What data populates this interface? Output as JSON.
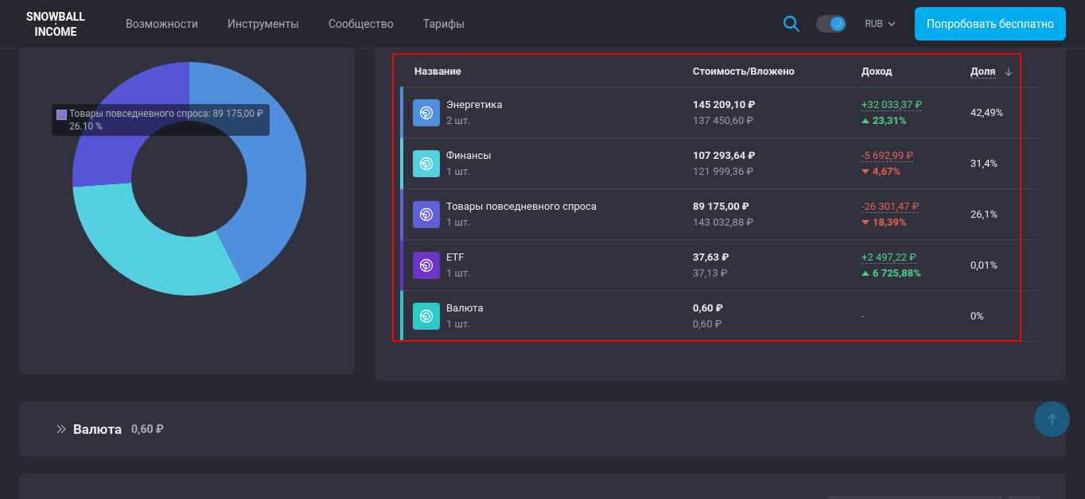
{
  "header": {
    "logo": [
      "SNOWBALL",
      "INCOME"
    ],
    "nav": [
      "Возможности",
      "Инструменты",
      "Сообщество",
      "Тарифы"
    ],
    "theme_toggle": {
      "on": true
    },
    "currency": "RUB",
    "cta": "Попробовать бесплатно"
  },
  "chart": {
    "tooltip": {
      "title": "Товары повседневного спроса: 89 175,00 ₽",
      "value": "26.10 %",
      "color": "#7b7bc8"
    }
  },
  "table": {
    "columns": [
      "Название",
      "Стоимость/Вложено",
      "Доход",
      "Доля"
    ],
    "rows": [
      {
        "name": "Энергетика",
        "qty": "2 шт.",
        "value": "145 209,10 ₽",
        "invested": "137 450,60 ₽",
        "kind": "up",
        "income": "+32 033,37 ₽",
        "percent": "23,31%",
        "share": "42,49%",
        "color": "#4f8fdb"
      },
      {
        "name": "Финансы",
        "qty": "1 шт.",
        "value": "107 293,64 ₽",
        "invested": "121 999,36 ₽",
        "kind": "down",
        "income": "-5 692,99 ₽",
        "percent": "4,67%",
        "share": "31,4%",
        "color": "#55d0e0"
      },
      {
        "name": "Товары повседневного спроса",
        "qty": "1 шт.",
        "value": "89 175,00 ₽",
        "invested": "143 032,88 ₽",
        "kind": "down",
        "income": "-26 301,47 ₽",
        "percent": "18,39%",
        "share": "26,1%",
        "color": "#5f5fd6"
      },
      {
        "name": "ETF",
        "qty": "1 шт.",
        "value": "37,63 ₽",
        "invested": "37,13 ₽",
        "kind": "up",
        "income": "+2 497,22 ₽",
        "percent": "6 725,88%",
        "share": "0,01%",
        "color": "#6a35c8"
      },
      {
        "name": "Валюта",
        "qty": "1 шт.",
        "value": "0,60 ₽",
        "invested": "0,60 ₽",
        "kind": "none",
        "income": "-",
        "share": "0%",
        "color": "#2ec9c9"
      }
    ]
  },
  "section": {
    "title": "Валюта",
    "amount": "0,60 ₽"
  }
}
